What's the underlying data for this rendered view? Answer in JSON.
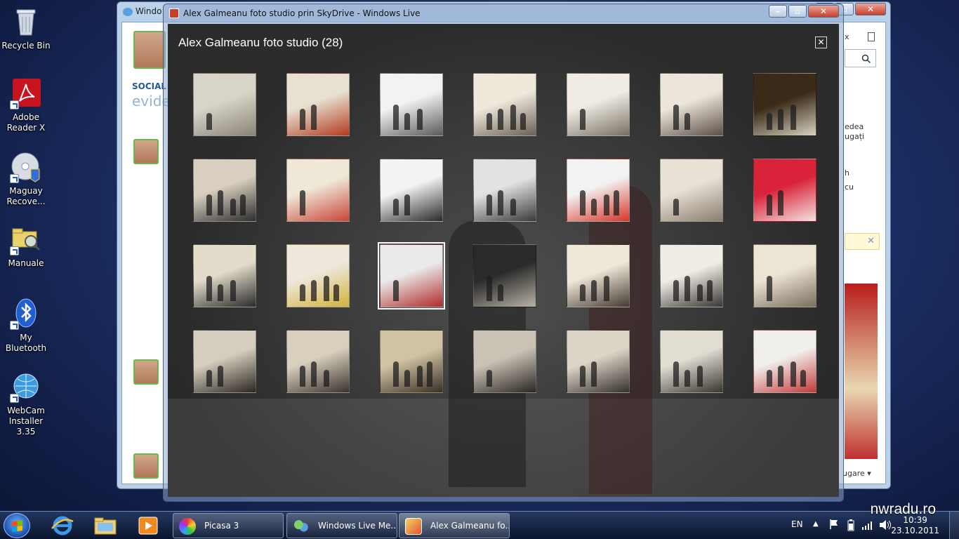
{
  "desktop": {
    "icons": [
      {
        "label": "Recycle Bin"
      },
      {
        "label": "Adobe Reader X"
      },
      {
        "label": "Maguay Recove..."
      },
      {
        "label": "Manuale"
      },
      {
        "label": "My Bluetooth"
      },
      {
        "label": "WebCam Installer 3.35"
      }
    ]
  },
  "background_window": {
    "title": "Windo",
    "social_label": "SOCIAL",
    "evid_label": "evide",
    "right_snippets": {
      "x_label": "x",
      "edea": "edea",
      "ugati": "ugați",
      "h": "h",
      "cu": "cu",
      "ugare": "ugare"
    }
  },
  "viewer": {
    "title": "Alex Galmeanu foto studio prin SkyDrive - Windows Live",
    "album_title": "Alex Galmeanu foto studio (28)",
    "close_glyph": "✕",
    "selected_index": 16,
    "thumbnails": [
      {
        "c1": "#d9d4c8",
        "c2": "#8a8478"
      },
      {
        "c1": "#e7e1d2",
        "c2": "#b33a1d"
      },
      {
        "c1": "#f2f2f0",
        "c2": "#5a5a5a"
      },
      {
        "c1": "#efe9dc",
        "c2": "#6b5f55"
      },
      {
        "c1": "#f0ece4",
        "c2": "#777064"
      },
      {
        "c1": "#ece6da",
        "c2": "#5c4f48"
      },
      {
        "c1": "#3a2a18",
        "c2": "#d8d2c2"
      },
      {
        "c1": "#d8cfc0",
        "c2": "#2d2d2d"
      },
      {
        "c1": "#efe8d6",
        "c2": "#c8453a"
      },
      {
        "c1": "#f3f3f3",
        "c2": "#2a2a2a"
      },
      {
        "c1": "#e2e2e2",
        "c2": "#3a3a3a"
      },
      {
        "c1": "#f2f2f2",
        "c2": "#d8352a"
      },
      {
        "c1": "#e8e2d6",
        "c2": "#8a7d70"
      },
      {
        "c1": "#d9233a",
        "c2": "#f2e3e0"
      },
      {
        "c1": "#e4dccb",
        "c2": "#2b2b2b"
      },
      {
        "c1": "#eee8dd",
        "c2": "#d3b23c"
      },
      {
        "c1": "#eaeaea",
        "c2": "#b02a2a"
      },
      {
        "c1": "#2a2a2a",
        "c2": "#b9b2a5"
      },
      {
        "c1": "#efe7d8",
        "c2": "#443a33"
      },
      {
        "c1": "#f1ede6",
        "c2": "#3a3633"
      },
      {
        "c1": "#ede5d4",
        "c2": "#7a6d5e"
      },
      {
        "c1": "#d5cdbd",
        "c2": "#2c2622"
      },
      {
        "c1": "#d8cfbd",
        "c2": "#3b342e"
      },
      {
        "c1": "#cfc3a3",
        "c2": "#3a2f26"
      },
      {
        "c1": "#c9c2b5",
        "c2": "#2b2623"
      },
      {
        "c1": "#ddd6c8",
        "c2": "#35302c"
      },
      {
        "c1": "#e2ddd3",
        "c2": "#3a3530"
      },
      {
        "c1": "#f0efec",
        "c2": "#c43a3a"
      }
    ]
  },
  "taskbar": {
    "buttons": [
      {
        "label": "Picasa 3"
      },
      {
        "label": "Windows Live Me..."
      },
      {
        "label": "Alex Galmeanu fo..."
      }
    ],
    "language": "EN",
    "time": "10:39",
    "date": "23.10.2011"
  },
  "watermark": "nwradu.ro",
  "colors": {
    "accent": "#1f5fcf",
    "avatar_border": "#6cb84c"
  }
}
